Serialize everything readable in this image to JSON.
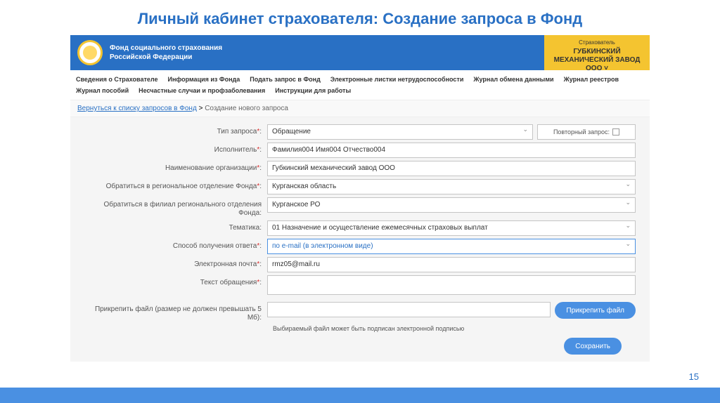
{
  "slide": {
    "title": "Личный кабинет страхователя: Создание запроса в Фонд",
    "page_number": "15"
  },
  "header": {
    "org_line1": "Фонд социального страхования",
    "org_line2": "Российской Федерации",
    "user_role": "Страхователь",
    "user_name": "ГУБКИНСКИЙ МЕХАНИЧЕСКИЙ ЗАВОД ООО ˅"
  },
  "nav": {
    "items": [
      "Сведения о Страхователе",
      "Информация из Фонда",
      "Подать запрос в Фонд",
      "Электронные листки нетрудоспособности",
      "Журнал обмена данными",
      "Журнал реестров",
      "Журнал пособий",
      "Несчастные случаи и профзаболевания",
      "Инструкции для работы"
    ]
  },
  "breadcrumb": {
    "link": "Вернуться к списку запросов в Фонд",
    "current": "Создание нового запроса"
  },
  "form": {
    "type_label": "Тип запроса",
    "type_value": "Обращение",
    "repeat_label": "Повторный запрос:",
    "executor_label": "Исполнитель",
    "executor_value": "Фамилия004 Имя004 Отчество004",
    "orgname_label": "Наименование организации",
    "orgname_value": "Губкинский механический завод ООО",
    "regional_label": "Обратиться в региональное отделение Фонда",
    "regional_value": "Курганская область",
    "branch_label": "Обратиться в филиал регионального отделения Фонда:",
    "branch_value": "Курганское РО",
    "topic_label": "Тематика:",
    "topic_value": "01   Назначение и осуществление ежемесячных страховых выплат",
    "delivery_label": "Способ получения ответа",
    "delivery_value": "по e-mail (в электронном виде)",
    "email_label": "Электронная почта",
    "email_value": "rmz05@mail.ru",
    "text_label": "Текст обращения",
    "attach_label": "Прикрепить файл (размер не должен превышать 5 Мб):",
    "attach_button": "Прикрепить файл",
    "attach_hint": "Выбираемый файл может быть подписан электронной подписью",
    "save_button": "Сохранить"
  }
}
